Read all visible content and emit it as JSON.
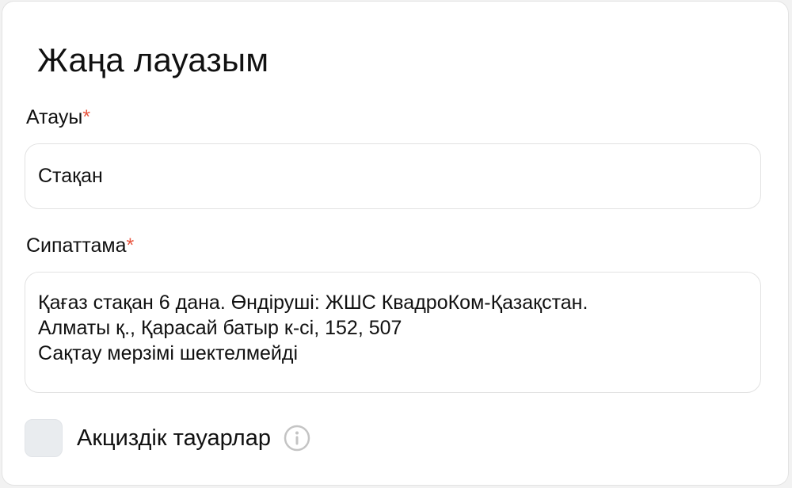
{
  "form": {
    "title": "Жаңа лауазым",
    "required_mark": "*",
    "name_field": {
      "label": "Атауы",
      "value": "Стақан"
    },
    "description_field": {
      "label": "Сипаттама",
      "value": "Қағаз стақан 6 дана. Өндіруші: ЖШС КвадроКом-Қазақстан.\nАлматы қ., Қарасай батыр к-сі, 152, 507\nСақтау мерзімі шектелмейді"
    },
    "excise_checkbox": {
      "label": "Акциздік тауарлар",
      "checked": false,
      "info_icon": "info-icon"
    }
  },
  "colors": {
    "required": "#e8553f",
    "checkbox_bg": "#e9ecef",
    "border": "#e2e2e2",
    "icon": "#c4c4c4"
  }
}
